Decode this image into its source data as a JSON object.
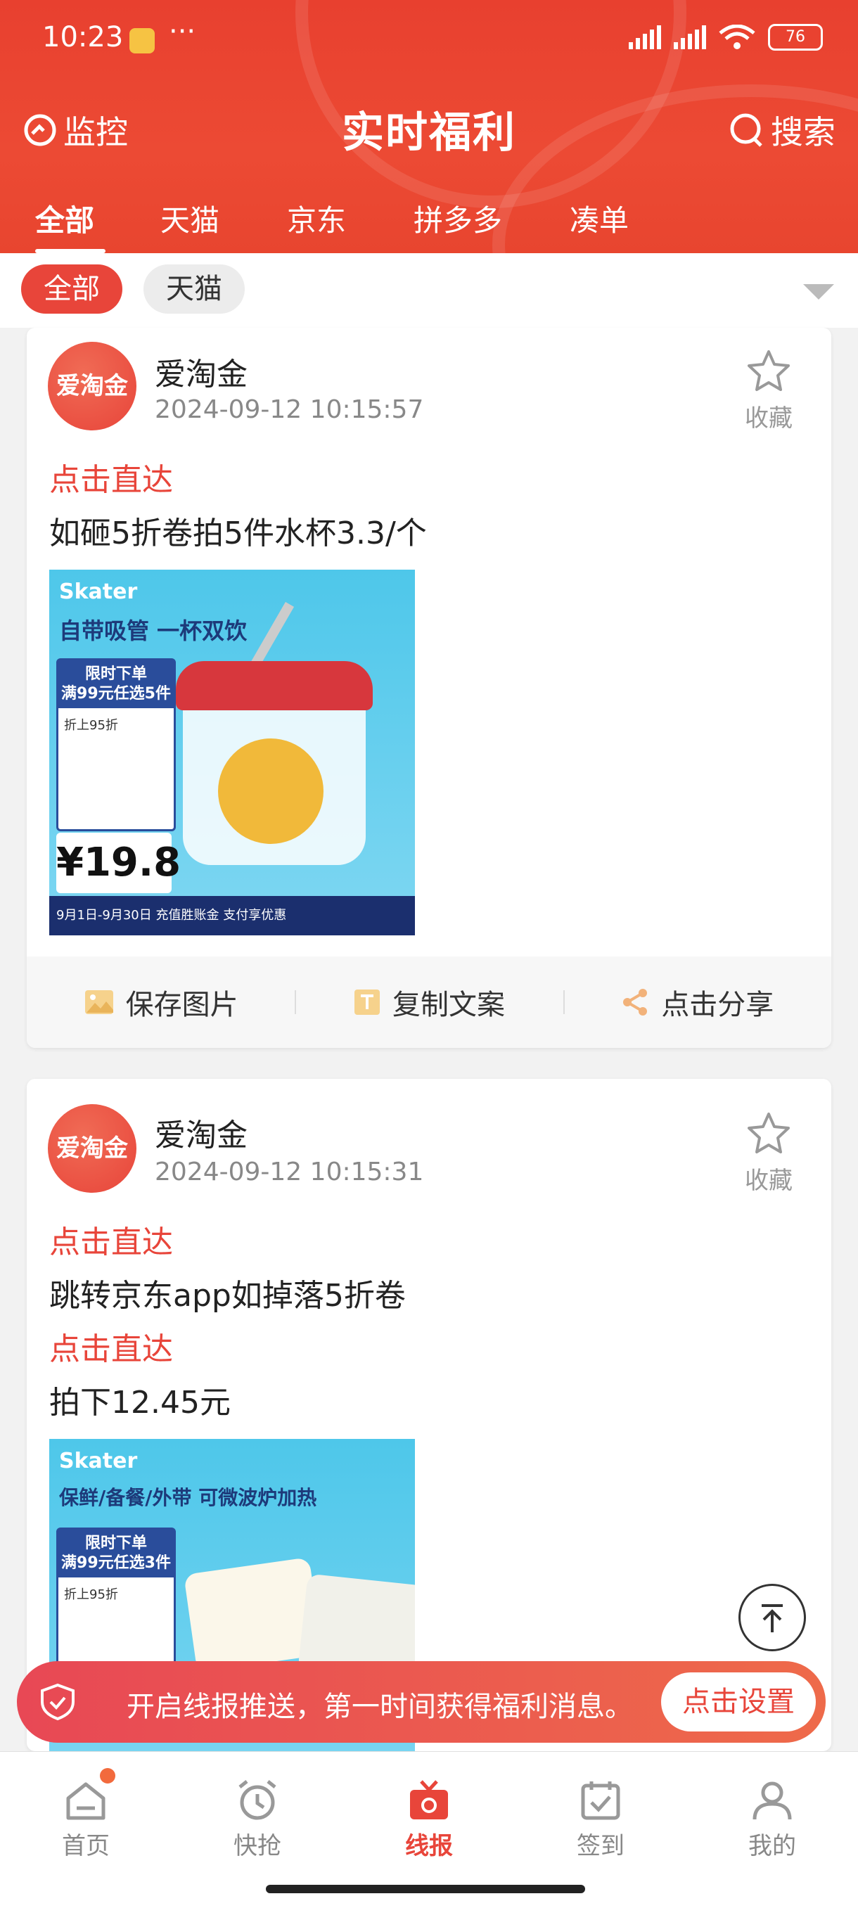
{
  "status_bar": {
    "time": "10:23",
    "dots": "···",
    "battery": "76"
  },
  "header": {
    "monitor_label": "监控",
    "title": "实时福利",
    "search_label": "搜索"
  },
  "tabs": [
    {
      "label": "全部"
    },
    {
      "label": "天猫"
    },
    {
      "label": "京东"
    },
    {
      "label": "拼多多"
    },
    {
      "label": "凑单"
    }
  ],
  "filter_chips": [
    {
      "label": "全部"
    },
    {
      "label": "天猫"
    }
  ],
  "posts": [
    {
      "author": "爱淘金",
      "avatar_text": "爱淘金",
      "time": "2024-09-12 10:15:57",
      "fav_label": "收藏",
      "lines": [
        {
          "type": "link",
          "text": "点击直达"
        },
        {
          "type": "text",
          "text": "如砸5折卷拍5件水杯3.3/个"
        }
      ],
      "image": {
        "brand": "Skater",
        "headline": "自带吸管 一杯双饮",
        "promo_title": "限时下单\n满99元任选5件",
        "promo_sub": "折上95折",
        "price": "¥19.8",
        "footer": "9月1日-9月30日 充值胜账金 支付享优惠"
      },
      "actions": {
        "save": "保存图片",
        "copy": "复制文案",
        "share": "点击分享"
      }
    },
    {
      "author": "爱淘金",
      "avatar_text": "爱淘金",
      "time": "2024-09-12 10:15:31",
      "fav_label": "收藏",
      "lines": [
        {
          "type": "link",
          "text": "点击直达"
        },
        {
          "type": "text",
          "text": "跳转京东app如掉落5折卷"
        },
        {
          "type": "link",
          "text": "点击直达"
        },
        {
          "type": "text",
          "text": "拍下12.45元"
        }
      ],
      "image": {
        "brand": "Skater",
        "headline": "保鲜/备餐/外带 可微波炉加热",
        "promo_title": "限时下单\n满99元任选3件",
        "promo_sub": "折上95折"
      }
    }
  ],
  "banner": {
    "text": "开启线报推送，第一时间获得福利消息。",
    "button": "点击设置"
  },
  "bottom_nav": [
    {
      "label": "首页"
    },
    {
      "label": "快抢"
    },
    {
      "label": "线报"
    },
    {
      "label": "签到"
    },
    {
      "label": "我的"
    }
  ],
  "colors": {
    "brand_red": "#e8453a",
    "header_red": "#ec4a34",
    "text": "#222222",
    "muted": "#888888"
  }
}
